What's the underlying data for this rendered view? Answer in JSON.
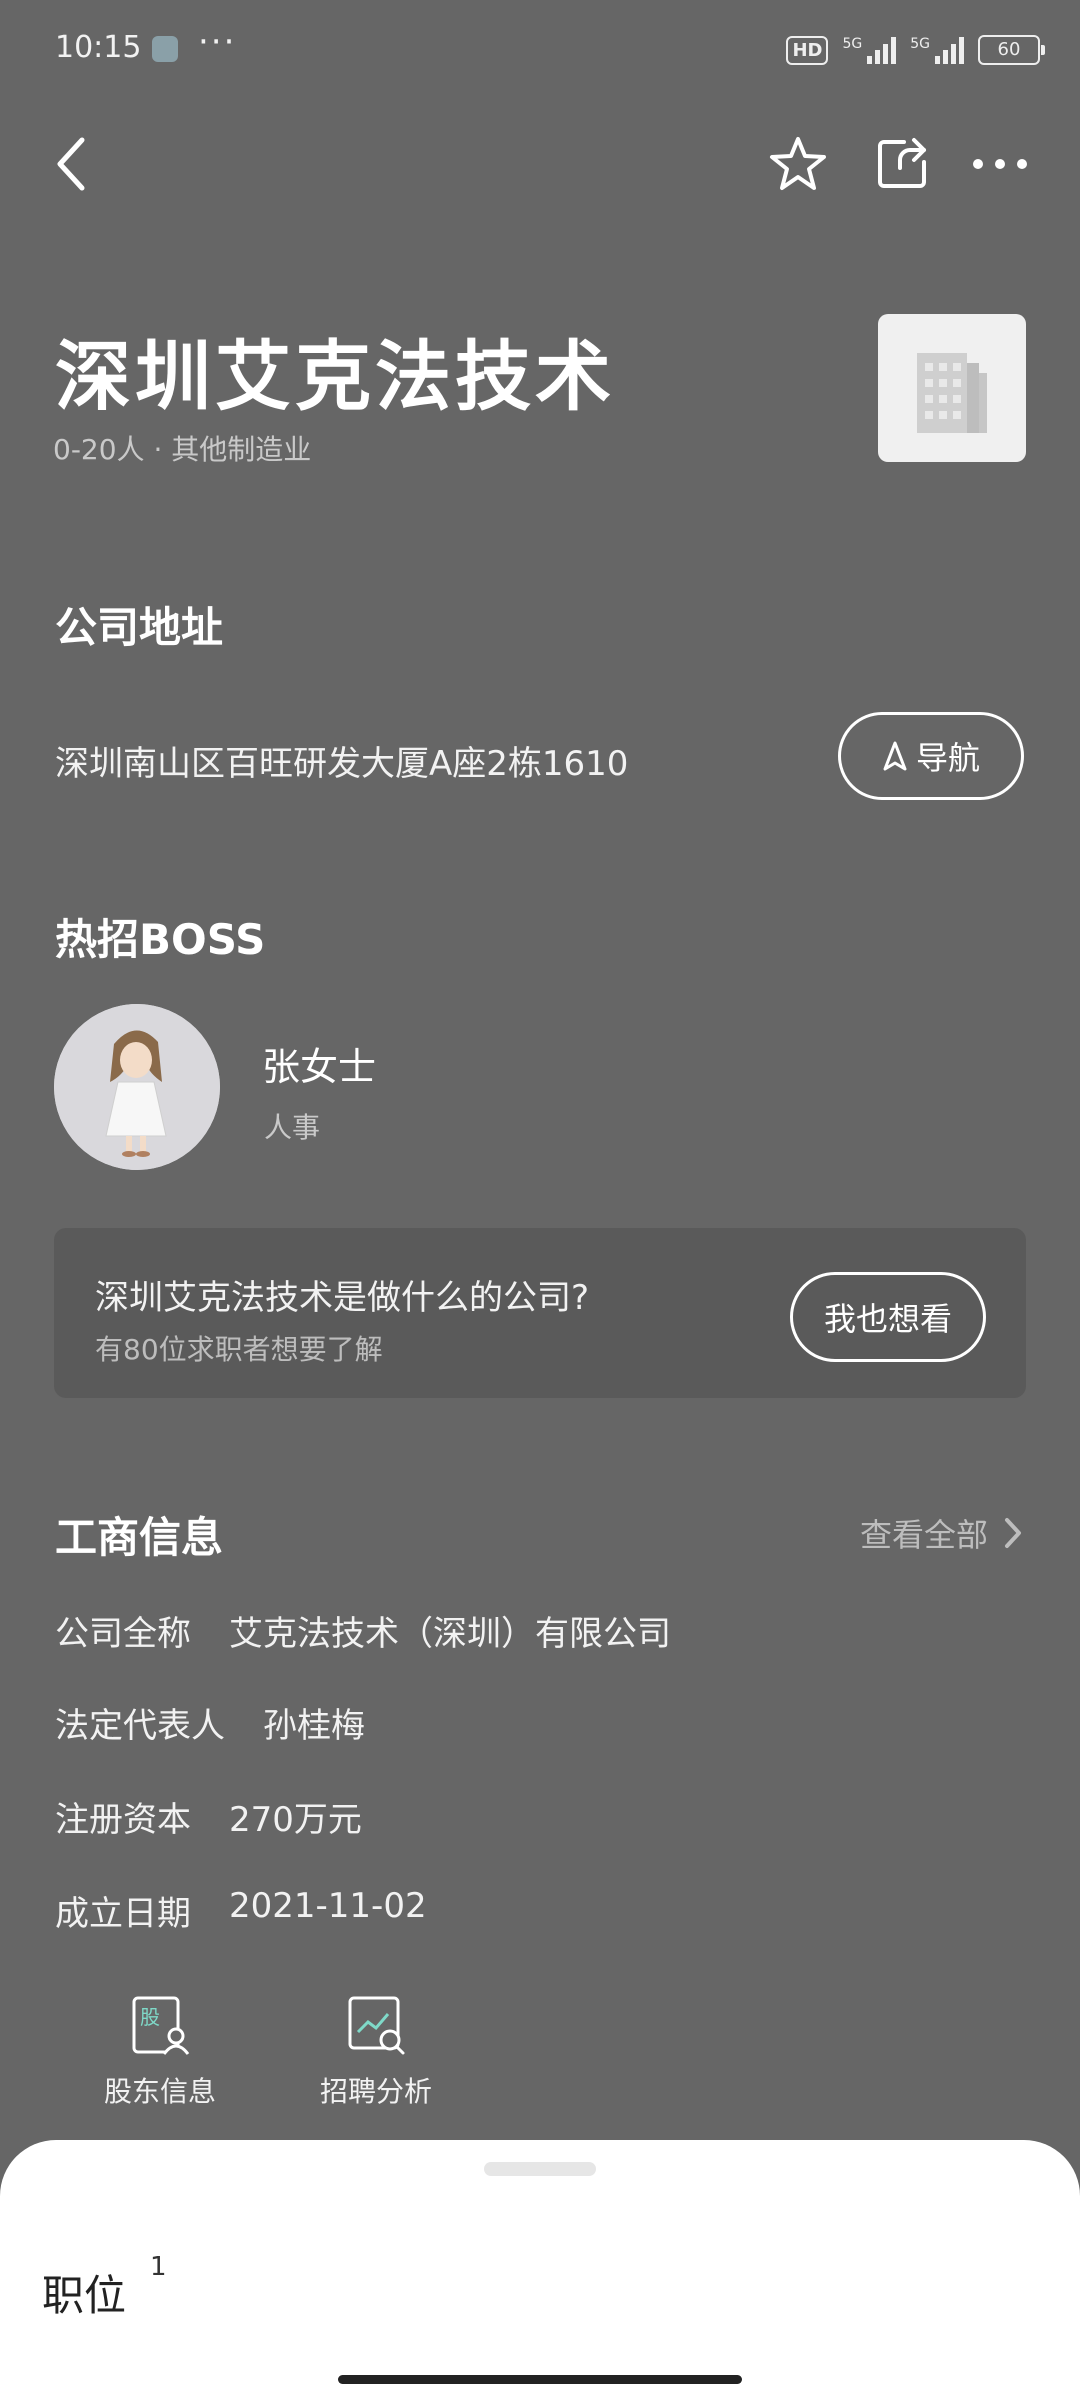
{
  "status_bar": {
    "time": "10:15",
    "more": "···",
    "hd_label": "HD",
    "signal1_label": "5G",
    "signal2_label": "5G",
    "battery": "60"
  },
  "header": {
    "back_icon": "chevron-left-icon",
    "favorite_icon": "star-icon",
    "share_icon": "share-icon",
    "more_icon": "more-icon"
  },
  "company": {
    "name": "深圳艾克法技术",
    "meta": "0-20人 · 其他制造业"
  },
  "address": {
    "section_title": "公司地址",
    "text": "深圳南山区百旺研发大厦A座2栋1610",
    "nav_label": "导航"
  },
  "boss": {
    "section_title": "热招BOSS",
    "name": "张女士",
    "role": "人事"
  },
  "ask": {
    "question": "深圳艾克法技术是做什么的公司?",
    "subtitle": "有80位求职者想要了解",
    "button": "我也想看"
  },
  "business_info": {
    "section_title": "工商信息",
    "view_all": "查看全部",
    "rows": [
      {
        "label": "公司全称",
        "value": "艾克法技术（深圳）有限公司"
      },
      {
        "label": "法定代表人",
        "value": "孙桂梅"
      },
      {
        "label": "注册资本",
        "value": "270万元"
      },
      {
        "label": "成立日期",
        "value": "2021-11-02"
      }
    ]
  },
  "features": [
    {
      "label": "股东信息",
      "icon": "shareholder-icon",
      "glyph": "股"
    },
    {
      "label": "招聘分析",
      "icon": "recruitment-analysis-icon"
    }
  ],
  "sheet": {
    "title": "职位",
    "count": "1"
  },
  "colors": {
    "background": "#666666",
    "sheet": "#ffffff",
    "card": "#5a5a5a"
  }
}
